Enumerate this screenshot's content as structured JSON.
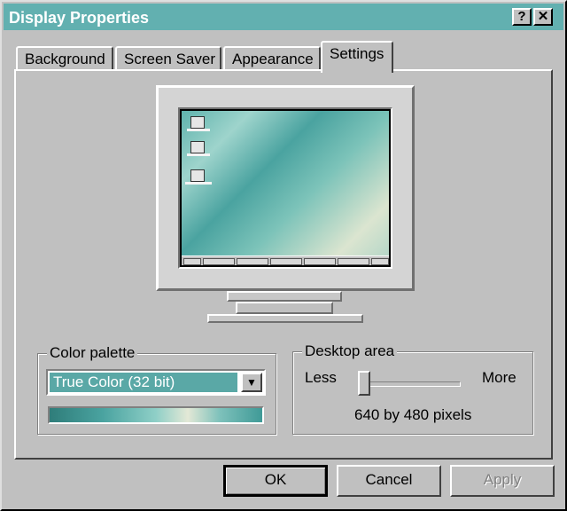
{
  "window": {
    "title": "Display Properties",
    "help_glyph": "?",
    "close_glyph": "✕"
  },
  "tabs": [
    {
      "label": "Background"
    },
    {
      "label": "Screen Saver"
    },
    {
      "label": "Appearance"
    },
    {
      "label": "Settings",
      "active": true
    }
  ],
  "color_palette": {
    "group_label": "Color palette",
    "selected_value": "True Color (32 bit)",
    "dropdown_glyph": "▼"
  },
  "desktop_area": {
    "group_label": "Desktop area",
    "less_label": "Less",
    "more_label": "More",
    "resolution_text": "640 by 480 pixels",
    "slider_position": 0
  },
  "buttons": {
    "ok": "OK",
    "cancel": "Cancel",
    "apply": "Apply"
  },
  "colors": {
    "titlebar": "#62b0b0",
    "face": "#c0c0c0",
    "selection": "#5aa8a6"
  }
}
